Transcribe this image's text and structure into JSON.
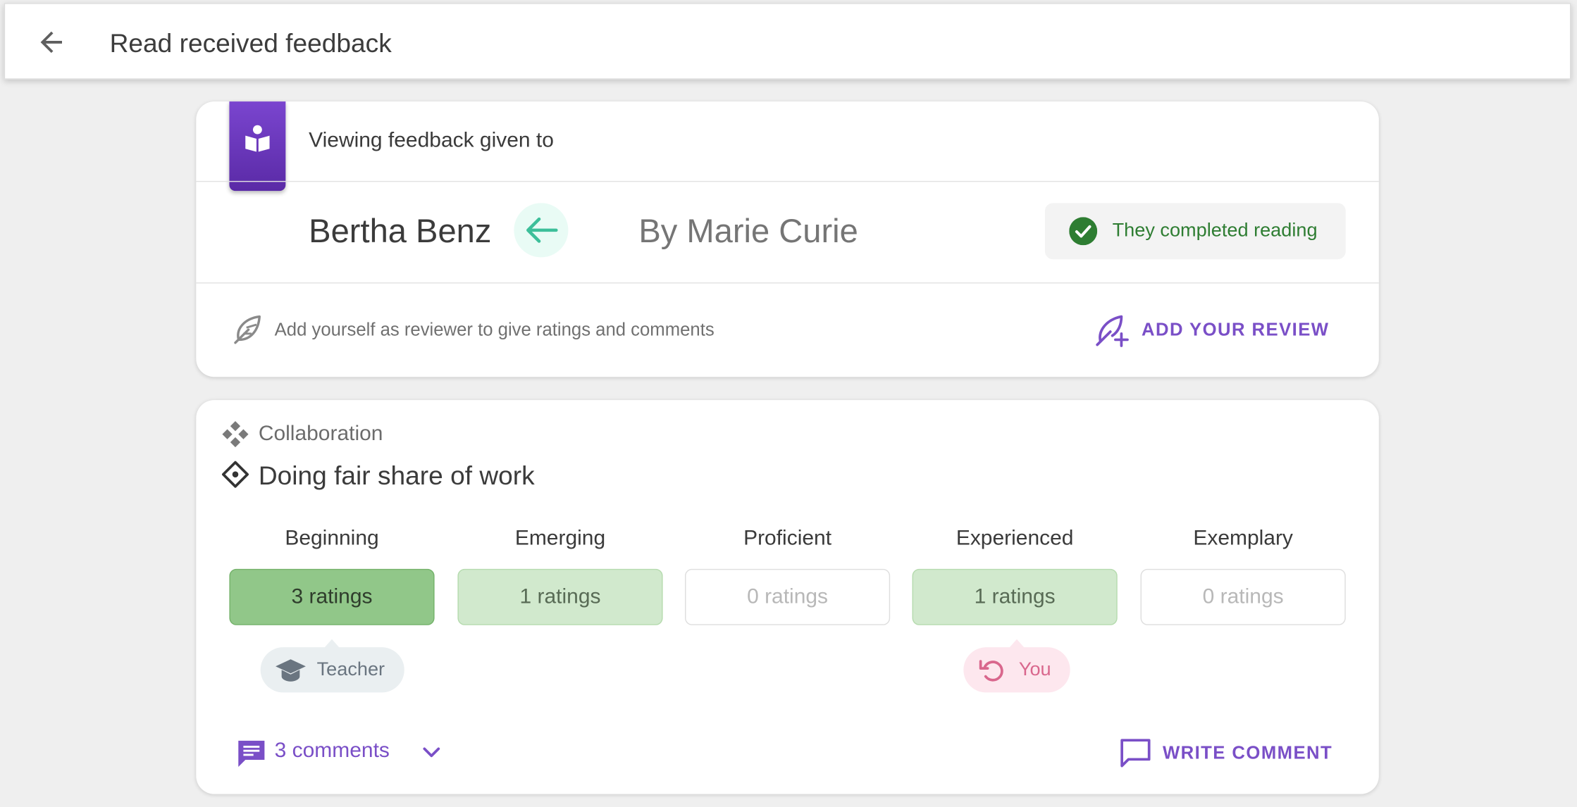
{
  "header": {
    "title": "Read received feedback"
  },
  "feedback": {
    "viewing_label": "Viewing feedback given to",
    "receiver": "Bertha Benz",
    "giver": "By Marie Curie",
    "status": "They completed reading",
    "hint": "Add yourself as reviewer to give ratings and comments",
    "add_review_label": "ADD YOUR REVIEW"
  },
  "criterion": {
    "category": "Collaboration",
    "skill": "Doing fair share of work",
    "levels": [
      {
        "name": "Beginning",
        "ratings": "3 ratings",
        "intensity": "strong"
      },
      {
        "name": "Emerging",
        "ratings": "1 ratings",
        "intensity": "light"
      },
      {
        "name": "Proficient",
        "ratings": "0 ratings",
        "intensity": "none"
      },
      {
        "name": "Experienced",
        "ratings": "1 ratings",
        "intensity": "light"
      },
      {
        "name": "Exemplary",
        "ratings": "0 ratings",
        "intensity": "none"
      }
    ],
    "tags": {
      "teacher": "Teacher",
      "you": "You"
    },
    "comments_label": "3 comments",
    "write_comment_label": "WRITE COMMENT"
  },
  "colors": {
    "accent": "#7a4fc7",
    "success": "#2e7d32",
    "rating_strong": "#91c789",
    "rating_light": "#d1e9cd",
    "arrow": "#3dbf9a"
  },
  "icons": {
    "back": "arrow-left-icon",
    "bookmark": "reading-person-icon",
    "direction": "arrow-left-icon",
    "status": "check-circle-icon",
    "hint": "feather-icon",
    "add_review": "feather-plus-icon",
    "category": "diamond-cluster-icon",
    "skill": "diamond-outline-icon",
    "teacher": "graduation-cap-icon",
    "you": "undo-icon",
    "comments": "comment-icon",
    "expand": "chevron-down-icon",
    "write_comment": "comment-outline-icon"
  }
}
